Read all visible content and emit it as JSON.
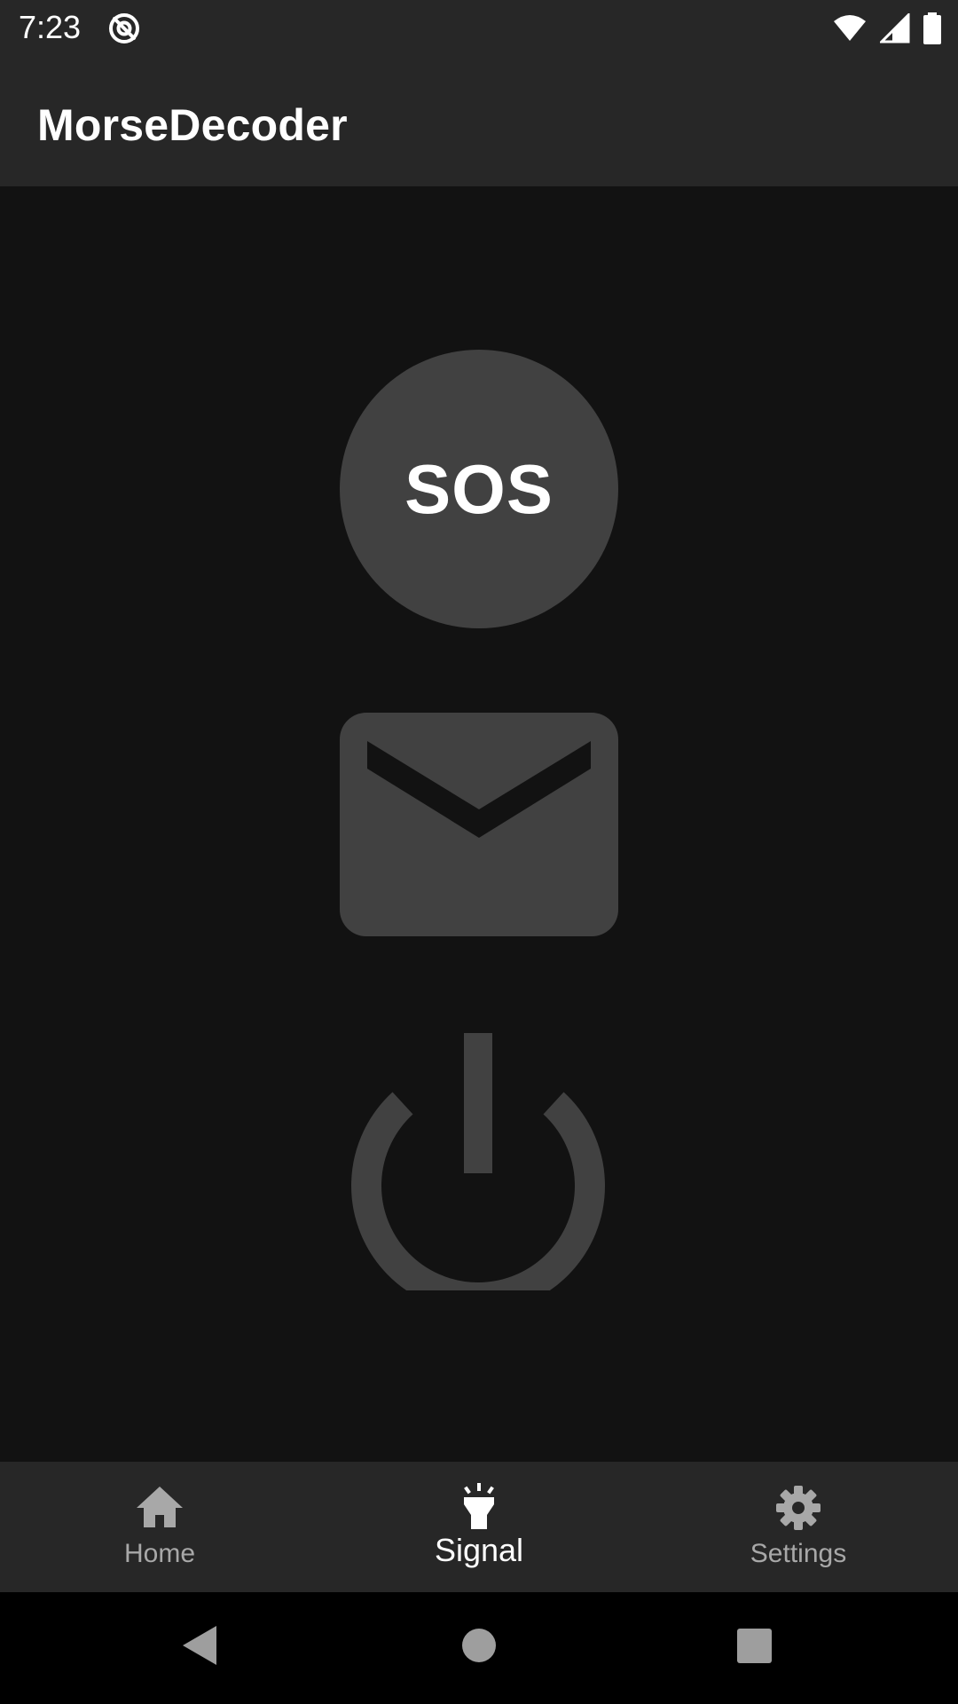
{
  "status_bar": {
    "time": "7:23"
  },
  "app_bar": {
    "title": "MorseDecoder"
  },
  "main": {
    "sos_label": "SOS"
  },
  "bottom_nav": {
    "items": [
      {
        "label": "Home",
        "icon": "home-icon",
        "active": false
      },
      {
        "label": "Signal",
        "icon": "flashlight-icon",
        "active": true
      },
      {
        "label": "Settings",
        "icon": "gear-icon",
        "active": false
      }
    ]
  },
  "colors": {
    "bar_background": "#272727",
    "content_background": "#121212",
    "button_fill": "#414141",
    "inactive_label": "#a8a8a8",
    "active_label": "#ffffff"
  }
}
